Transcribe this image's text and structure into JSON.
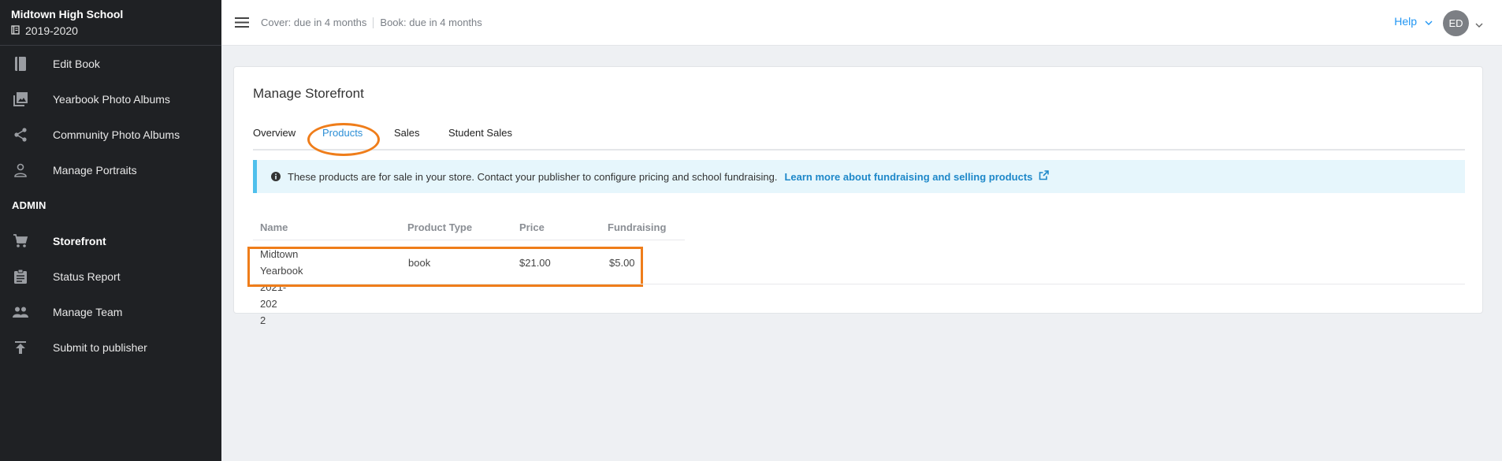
{
  "sidebar": {
    "school": "Midtown High School",
    "year": "2019-2020",
    "items": [
      {
        "label": "Edit Book",
        "icon": "book-icon"
      },
      {
        "label": "Yearbook Photo Albums",
        "icon": "photo-album-icon"
      },
      {
        "label": "Community Photo Albums",
        "icon": "share-icon"
      },
      {
        "label": "Manage Portraits",
        "icon": "person-icon"
      }
    ],
    "admin_label": "ADMIN",
    "admin_items": [
      {
        "label": "Storefront",
        "icon": "cart-icon",
        "active": true
      },
      {
        "label": "Status Report",
        "icon": "clipboard-icon"
      },
      {
        "label": "Manage Team",
        "icon": "people-icon"
      },
      {
        "label": "Submit to publisher",
        "icon": "upload-icon"
      }
    ]
  },
  "header": {
    "cover_due": "Cover: due in 4 months",
    "book_due": "Book: due in 4 months",
    "help": "Help",
    "avatar_initials": "ED"
  },
  "main": {
    "title": "Manage Storefront",
    "tabs": [
      {
        "label": "Overview"
      },
      {
        "label": "Products",
        "active": true
      },
      {
        "label": "Sales"
      },
      {
        "label": "Student Sales"
      }
    ],
    "alert": {
      "text": "These products are for sale in your store. Contact your publisher to configure pricing and school fundraising.",
      "link": "Learn more about fundraising and selling products"
    },
    "table": {
      "headers": [
        "Name",
        "Product Type",
        "Price",
        "Fundraising"
      ],
      "rows": [
        {
          "name_line1": "Midtown Yearbook 2021-202",
          "name_line2": "2",
          "type": "book",
          "price": "$21.00",
          "fundraising": "$5.00"
        }
      ]
    }
  },
  "colors": {
    "sidebar_bg": "#1f2124",
    "accent": "#2b8ed6",
    "highlight": "#ef7d1a",
    "alert_bg": "#e6f6fc"
  }
}
